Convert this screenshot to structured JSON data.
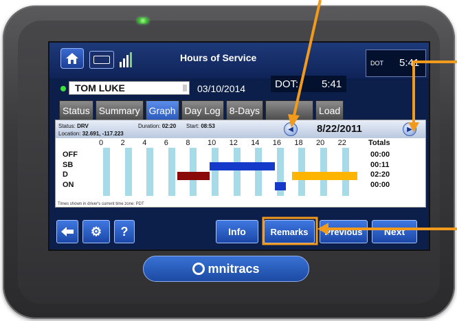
{
  "header": {
    "title": "Hours of Service",
    "dot_label": "DOT",
    "dot_value": "5:41"
  },
  "driver": {
    "name": "TOM LUKE",
    "date": "03/10/2014",
    "dot_label": "DOT:",
    "dot_value": "5:41"
  },
  "tabs": [
    {
      "label": "Status",
      "active": false
    },
    {
      "label": "Summary",
      "active": false
    },
    {
      "label": "Graph",
      "active": true
    },
    {
      "label": "Day Log",
      "active": false
    },
    {
      "label": "8-Days",
      "active": false
    },
    {
      "label": "",
      "active": false
    },
    {
      "label": "Load",
      "active": false
    }
  ],
  "status_info": {
    "status_label": "Status:",
    "status_value": "DRV",
    "location_label": "Location:",
    "location_value": "32.691, -117.223",
    "duration_label": "Duration:",
    "duration_value": "02:20",
    "start_label": "Start:",
    "start_value": "08:53",
    "nav_date": "8/22/2011"
  },
  "graph": {
    "hour_labels": [
      "0",
      "2",
      "4",
      "6",
      "8",
      "10",
      "12",
      "14",
      "16",
      "18",
      "20",
      "22"
    ],
    "rows": [
      "OFF",
      "SB",
      "D",
      "ON"
    ],
    "totals_header": "Totals",
    "totals": [
      "00:00",
      "00:11",
      "02:20",
      "00:00"
    ],
    "footnote": "Times shown in driver's current time zone:  PDT",
    "segments": [
      {
        "row": "SB",
        "start_hour": 10.0,
        "end_hour": 16.0,
        "color": "#1539c9"
      },
      {
        "row": "D",
        "start_hour": 7.0,
        "end_hour": 10.0,
        "color": "#8a0a0a"
      },
      {
        "row": "D",
        "start_hour": 17.6,
        "end_hour": 23.6,
        "color": "#ffb400"
      },
      {
        "row": "ON",
        "start_hour": 16.0,
        "end_hour": 17.0,
        "color": "#1539c9"
      }
    ]
  },
  "buttons": {
    "info": "Info",
    "remarks": "Remarks",
    "previous": "Previous",
    "next": "Next"
  },
  "brand": {
    "text": "mnitracs"
  },
  "colors": {
    "accent": "#f29a1b",
    "screen_bg": "#0c1f4a",
    "button_blue": "#2a5bc4",
    "stripe": "#a8dbe8"
  }
}
